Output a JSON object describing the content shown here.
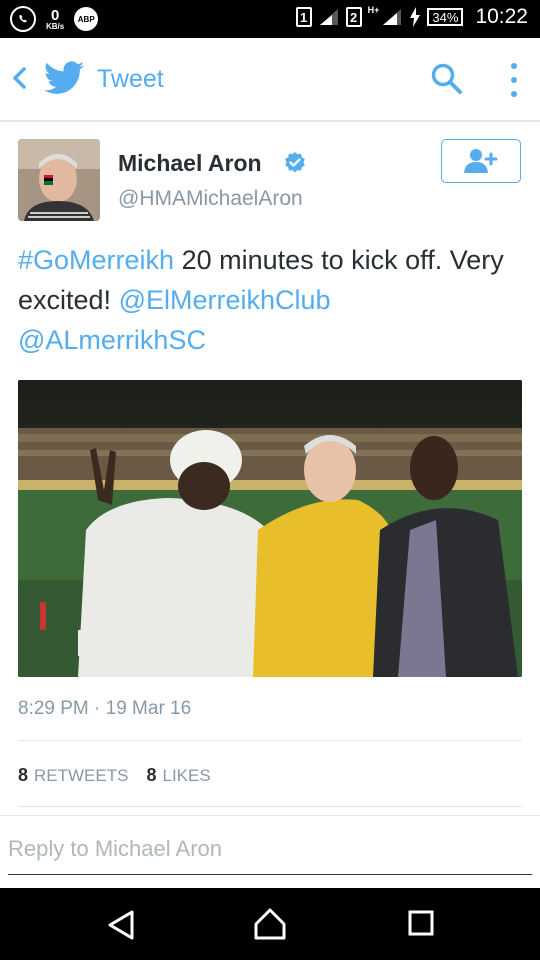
{
  "status_bar": {
    "speed_value": "0",
    "speed_unit": "KB/s",
    "adblock_label": "ABP",
    "sim1": "1",
    "sim2": "2",
    "network_type": "H+",
    "battery": "34%",
    "time": "10:22"
  },
  "header": {
    "title": "Tweet",
    "accent_color": "#55acee"
  },
  "tweet": {
    "author_name": "Michael Aron",
    "author_handle": "@HMAMichaelAron",
    "verified": true,
    "text_parts": {
      "hashtag": "#GoMerreikh",
      "text1": " 20 minutes to kick off. Very excited! ",
      "mention1": "@ElMerreikhClub",
      "mention2": "@ALmerrikhSC"
    },
    "timestamp": "8:29 PM · 19 Mar 16",
    "retweets_count": "8",
    "retweets_label": "RETWEETS",
    "likes_count": "8",
    "likes_label": "LIKES"
  },
  "reply": {
    "placeholder": "Reply to Michael Aron"
  },
  "icons": {
    "status": [
      "whatsapp-icon",
      "adblock-icon",
      "signal-icon",
      "charging-icon",
      "battery-icon"
    ],
    "header": [
      "back-icon",
      "twitter-bird-icon",
      "search-icon",
      "more-icon"
    ],
    "tweet": [
      "verified-icon",
      "follow-user-icon"
    ],
    "nav": [
      "nav-back-icon",
      "nav-home-icon",
      "nav-recents-icon"
    ]
  }
}
